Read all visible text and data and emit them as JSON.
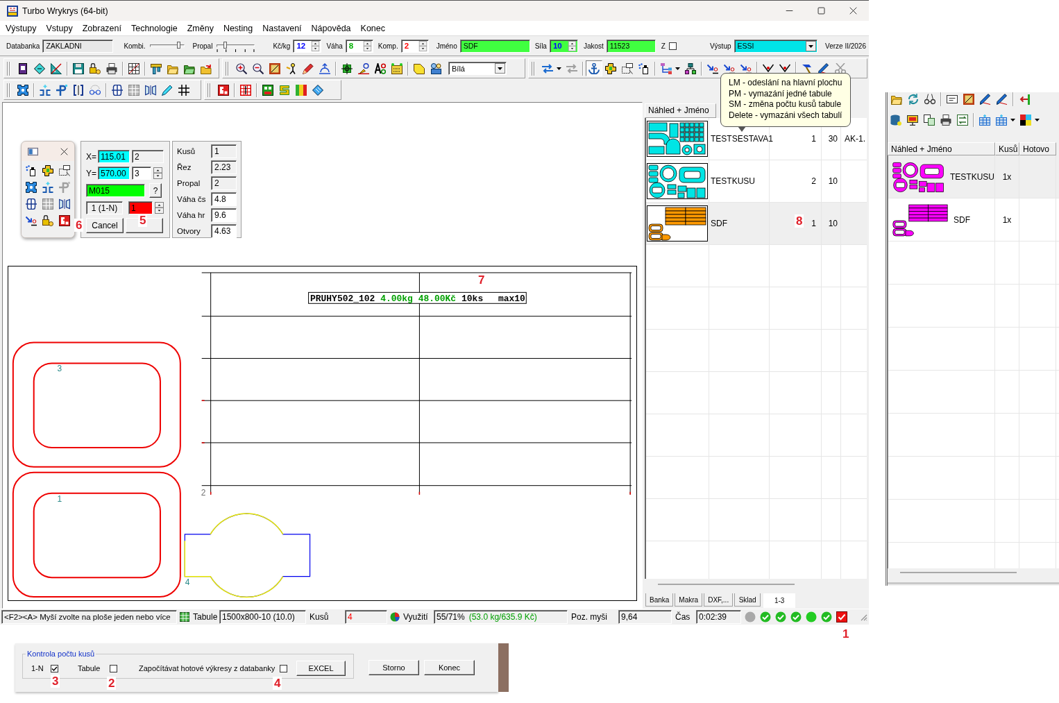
{
  "window": {
    "title": "Turbo Wrykrys (64-bit)"
  },
  "menu": [
    "Výstupy",
    "Vstupy",
    "Zobrazení",
    "Technologie",
    "Změny",
    "Nesting",
    "Nastavení",
    "Nápověda",
    "Konec"
  ],
  "parameters": [
    {
      "kind": "text",
      "label": "Databanka",
      "value": "ZAKLADNI",
      "color": "#e8e8e8"
    },
    {
      "kind": "slider",
      "label": "Kombi.",
      "level": 0.86,
      "ticks": false
    },
    {
      "kind": "slider",
      "label": "Propal",
      "level": 0.22,
      "ticks": true
    },
    {
      "kind": "spin",
      "label": "Kč/kg",
      "value": {
        "text": "12",
        "color": "#0000ff"
      },
      "color": "#ffffff"
    },
    {
      "kind": "spin",
      "label": "Váha",
      "value": {
        "text": "8",
        "color": "#00b000"
      },
      "color": "#ffffff"
    },
    {
      "kind": "spin",
      "label": "Komp.",
      "value": {
        "text": "2",
        "color": "#ff0000"
      },
      "color": "#ffffff"
    },
    {
      "kind": "text",
      "label": "Jméno",
      "value": "SDF",
      "color": "#40ff40"
    },
    {
      "kind": "spin",
      "label": "Síla",
      "value": {
        "text": "10",
        "color": "#0000ff"
      },
      "color": "#40ff40"
    },
    {
      "kind": "text",
      "label": "Jakost",
      "value": "11523",
      "color": "#40ff40"
    },
    {
      "kind": "checkbox",
      "label": "Z",
      "checked": false
    },
    {
      "kind": "dropdown",
      "label": "Výstup",
      "value": "ESSI",
      "color": "#00e4e8"
    },
    {
      "kind": "caption",
      "label": "Verze II/2026"
    }
  ],
  "toolbar": {
    "color_select": "Bílá"
  },
  "edit_panel": {
    "x_label": "X=",
    "x_value": "115.01",
    "x_extra": "2",
    "y_label": "Y=",
    "y_value": "570.00",
    "y_extra": "3",
    "material": "M015",
    "help_button": "?",
    "mode": "1 (1-N)",
    "count": "1",
    "cancel_button": "Cancel"
  },
  "stats": [
    {
      "label": "Kusů",
      "value": "1",
      "readonly": true
    },
    {
      "label": "Řez",
      "value": "2.23",
      "readonly": true
    },
    {
      "label": "Propal",
      "value": "2",
      "readonly": true
    },
    {
      "label": "Váha čs",
      "value": "4.8",
      "readonly": false
    },
    {
      "label": "Váha hr",
      "value": "9.6",
      "readonly": false
    },
    {
      "label": "Otvory",
      "value": "4.63",
      "readonly": false
    }
  ],
  "canvas": {
    "sheet": {
      "number": "2",
      "label": [
        {
          "text": "PRUHY502_102",
          "color": "#000000"
        },
        {
          "text": "4.00kg",
          "color": "#00a000"
        },
        {
          "text": "48.00Kč",
          "color": "#00a000"
        },
        {
          "text": "10ks",
          "color": "#000000"
        },
        {
          "text": "max10",
          "color": "#000000"
        }
      ]
    },
    "parts": [
      {
        "kind": "frame",
        "number": "3"
      },
      {
        "kind": "frame",
        "number": "1"
      },
      {
        "kind": "round-plate",
        "number": "4"
      }
    ]
  },
  "sheet_list": {
    "header": "Náhled + Jméno",
    "rows": [
      {
        "kind": "assembly",
        "color": "#00e5e5",
        "name": "TESTSESTAVA1",
        "column_3": "1",
        "column_4": "30",
        "column_5": "AK-1.",
        "selected": false
      },
      {
        "kind": "parts",
        "color": "#00e5e5",
        "name": "TESTKUSU",
        "column_3": "2",
        "column_4": "10",
        "selected": false
      },
      {
        "kind": "strips",
        "color": "#ff9900",
        "name": "SDF",
        "column_3": "1",
        "column_4": "10",
        "selected": true
      }
    ],
    "tabs": [
      {
        "label": "Banka",
        "selected": false
      },
      {
        "label": "Makra",
        "selected": false
      },
      {
        "label": "DXF,...",
        "selected": false
      },
      {
        "label": "Sklad",
        "selected": false
      },
      {
        "label": "1-3",
        "selected": true
      }
    ]
  },
  "tooltip": [
    "LM - odeslání na hlavní plochu",
    "PM - vymazání jedné tabule",
    "SM - změna počtu kusů tabule",
    "Delete - vymazáni všech tabulí"
  ],
  "status_bar": {
    "hint": "<F2><A> Myší zvolte na ploše jeden nebo více",
    "sheet_label": "Tabule",
    "sheet": "1500x800-10 (10.0)",
    "pieces_label": "Kusů",
    "pieces": "4",
    "usage_label": "Využití",
    "usage": "55/71%",
    "usage_detail": "(53.0 kg/635.9 Kč)",
    "mouse_label": "Poz. myši",
    "mouse": "9,64",
    "time_label": "Čas",
    "time": "0:02:39",
    "indicators": [
      {
        "kind": "circle",
        "color": "#a8a8a8"
      },
      {
        "kind": "check",
        "color": "#22bb22"
      },
      {
        "kind": "check",
        "color": "#22bb22"
      },
      {
        "kind": "check",
        "color": "#22bb22"
      },
      {
        "kind": "circle",
        "color": "#22cc22"
      },
      {
        "kind": "check",
        "color": "#22bb22"
      },
      {
        "kind": "box-check",
        "color": "#ee1111"
      }
    ]
  },
  "side_window": {
    "columns": [
      "Náhled + Jméno",
      "Kusů",
      "Hotovo"
    ],
    "rows": [
      {
        "kind": "parts",
        "color": "#ff00ff",
        "name": "TESTKUSU",
        "count": "1x",
        "selected": true
      },
      {
        "kind": "strips",
        "color": "#ff00ff",
        "name": "SDF",
        "count": "1x",
        "selected": false
      }
    ]
  },
  "dialog": {
    "legend": "Kontrola počtu kusů",
    "options": [
      {
        "label": "1-N",
        "checked": true
      },
      {
        "label": "Tabule",
        "checked": false
      },
      {
        "label": "Započítávat hotové výkresy z databanky",
        "checked": false
      }
    ],
    "excel_button": "EXCEL",
    "buttons": [
      "Storno",
      "Konec"
    ]
  },
  "annotations": [
    "6",
    "5",
    "8",
    "7",
    "1",
    "3",
    "2",
    "4"
  ]
}
